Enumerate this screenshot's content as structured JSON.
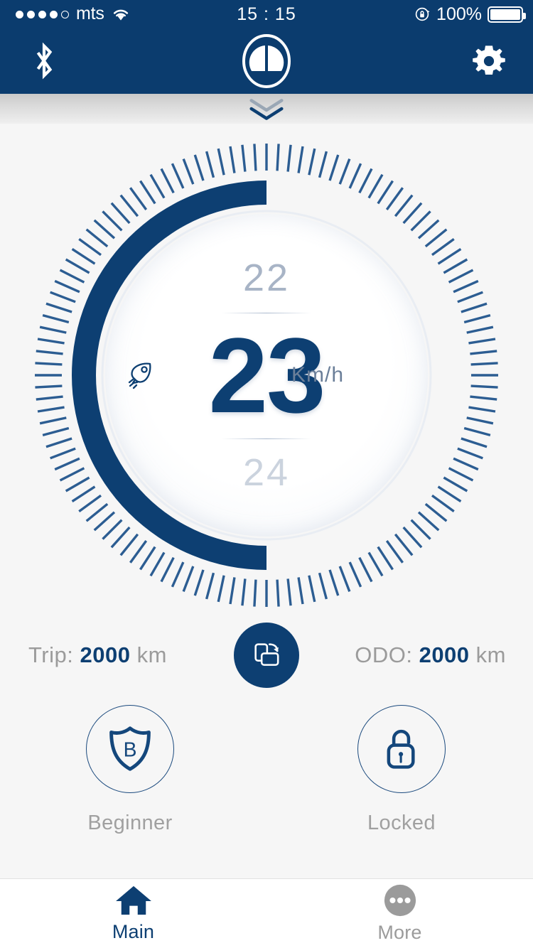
{
  "status_bar": {
    "carrier": "mts",
    "signal_dots_filled": 4,
    "signal_dots_total": 5,
    "wifi_icon": "wifi-icon",
    "time": "15 : 15",
    "rotation_lock_icon": "rotation-lock-icon",
    "battery_percent": "100%",
    "battery_icon": "battery-full-icon"
  },
  "nav_bar": {
    "bluetooth_icon": "bluetooth-icon",
    "logo_icon": "app-logo-icon",
    "settings_icon": "gear-icon",
    "background_color": "#0b3c6e"
  },
  "pull_handle": {
    "icon": "double-chevron-down-icon"
  },
  "gauge": {
    "previous_speed": "22",
    "current_speed": "23",
    "next_speed": "24",
    "unit": "Km/h",
    "mode_icon": "rocket-icon",
    "arc_color": "#0d3f72",
    "tick_color": "#2c5d92",
    "arc_fill_fraction": 0.5,
    "tick_count": 120
  },
  "trip": {
    "trip_label": "Trip:",
    "trip_value": "2000",
    "trip_unit": "km",
    "odo_label": "ODO:",
    "odo_value": "2000",
    "odo_unit": "km",
    "reset_button_icon": "reset-trip-icon"
  },
  "modes": [
    {
      "icon": "shield-b-icon",
      "label": "Beginner"
    },
    {
      "icon": "padlock-icon",
      "label": "Locked"
    }
  ],
  "tab_bar": {
    "tabs": [
      {
        "icon": "home-icon",
        "label": "Main",
        "active": true
      },
      {
        "icon": "more-dots-icon",
        "label": "More",
        "active": false
      }
    ],
    "active_color": "#0d3f72",
    "inactive_color": "#9b9b9b"
  }
}
